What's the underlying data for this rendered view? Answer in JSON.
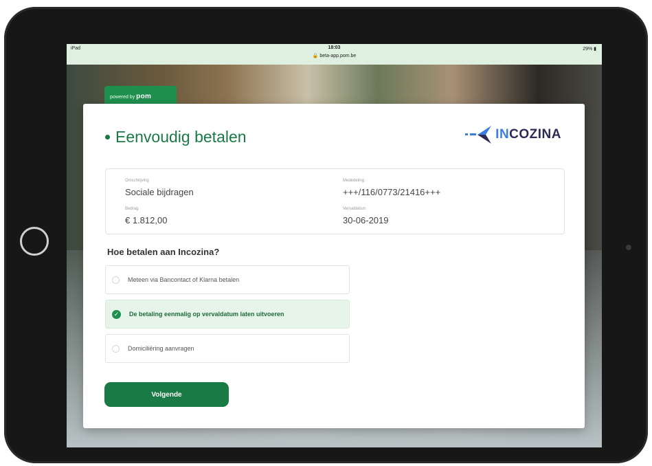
{
  "status": {
    "device": "iPad",
    "time": "18:03",
    "url": "beta-app.pom.be",
    "battery": "29%"
  },
  "branding": {
    "powered_by": "powered by",
    "powered_brand": "pom"
  },
  "card": {
    "title": "Eenvoudig betalen",
    "logo": {
      "prefix": "IN",
      "rest": "COZINA"
    }
  },
  "details": {
    "description_label": "Omschrijving",
    "description_value": "Sociale bijdragen",
    "reference_label": "Mededeling",
    "reference_value": "+++/116/0773/21416+++",
    "amount_label": "Bedrag",
    "amount_value": "€ 1.812,00",
    "due_label": "Vervaldatum",
    "due_value": "30-06-2019"
  },
  "question": "Hoe betalen aan Incozina?",
  "options": [
    {
      "label": "Meteen via Bancontact of Klarna betalen",
      "selected": false
    },
    {
      "label": "De betaling eenmalig op vervaldatum laten uitvoeren",
      "selected": true
    },
    {
      "label": "Domiciliëring aanvragen",
      "selected": false
    }
  ],
  "next_button": "Volgende",
  "colors": {
    "brand_green": "#1a7a46",
    "selected_bg": "#e7f4e9"
  }
}
